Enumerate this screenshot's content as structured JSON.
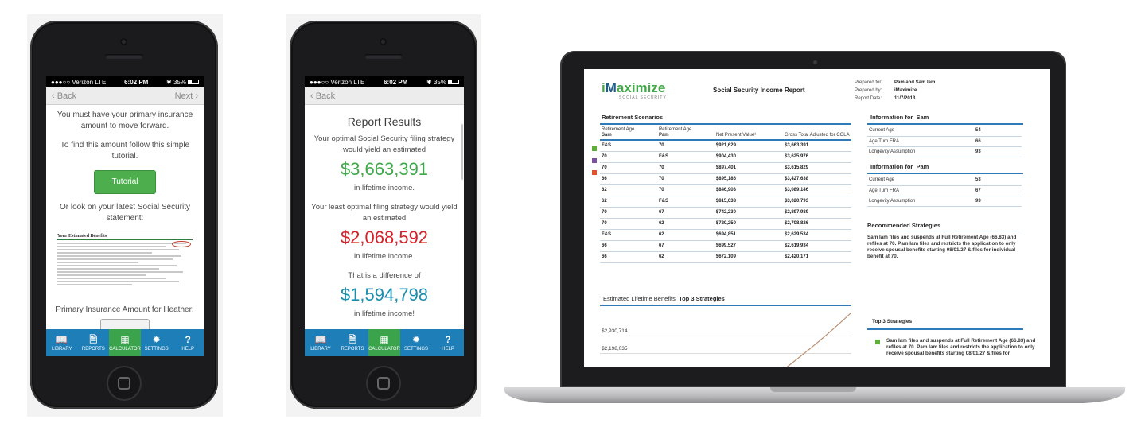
{
  "phone1": {
    "status": {
      "carrier": "●●●○○ Verizon  LTE",
      "time": "6:02 PM",
      "battery": "✱ 35%"
    },
    "nav": {
      "back": "‹  Back",
      "next": "Next  ›"
    },
    "text1": "You must have your primary insurance amount to move forward.",
    "text2": "To find this amount follow this simple tutorial.",
    "tutorial_button": "Tutorial",
    "text3": "Or look on your latest Social Security statement:",
    "statement_title": "Your Estimated Benefits",
    "pia_label": "Primary Insurance Amount for Heather:"
  },
  "phone2": {
    "status": {
      "carrier": "●●●○○ Verizon  LTE",
      "time": "6:02 PM",
      "battery": "✱ 35%"
    },
    "nav": {
      "back": "‹  Back"
    },
    "title": "Report Results",
    "optimal_text": "Your optimal Social Security filing strategy would yield an estimated",
    "optimal_amount": "$3,663,391",
    "lifetime1": "in lifetime income.",
    "least_text": "Your least optimal filing strategy would yield an estimated",
    "least_amount": "$2,068,592",
    "lifetime2": "in lifetime income.",
    "diff_text": "That is a difference of",
    "diff_amount": "$1,594,798",
    "lifetime3": "in lifetime income!"
  },
  "tabs": [
    {
      "icon": "📖",
      "label": "LIBRARY"
    },
    {
      "icon": "🗎",
      "label": "REPORTS"
    },
    {
      "icon": "▦",
      "label": "CALCULATOR"
    },
    {
      "icon": "✹",
      "label": "SETTINGS"
    },
    {
      "icon": "?",
      "label": "HELP"
    }
  ],
  "report": {
    "logo_i": "i",
    "logo_m": "M",
    "logo_rest": "aximize",
    "logo_sub": "SOCIAL SECURITY",
    "title": "Social Security Income Report",
    "prepared_for_label": "Prepared for:",
    "prepared_for": "Pam and Sam Iam",
    "prepared_by_label": "Prepared by:",
    "prepared_by": "iMaximize",
    "date_label": "Report Date:",
    "date": "11/7/2013",
    "scenarios_heading": "Retirement Scenarios",
    "columns": {
      "sam_age": "Retirement Age",
      "sam": "Sam",
      "pam_age": "Retirement Age",
      "pam": "Pam",
      "npv": "Net Present Value¹",
      "gross": "Gross Total Adjusted for COLA"
    },
    "rows": [
      {
        "sam": "F&S",
        "pam": "70",
        "npv": "$921,629",
        "gross": "$3,663,391"
      },
      {
        "sam": "70",
        "pam": "F&S",
        "npv": "$904,430",
        "gross": "$3,625,976"
      },
      {
        "sam": "70",
        "pam": "70",
        "npv": "$897,401",
        "gross": "$3,615,829"
      },
      {
        "sam": "66",
        "pam": "70",
        "npv": "$895,186",
        "gross": "$3,427,638"
      },
      {
        "sam": "62",
        "pam": "70",
        "npv": "$846,903",
        "gross": "$3,089,146"
      },
      {
        "sam": "62",
        "pam": "F&S",
        "npv": "$815,038",
        "gross": "$3,020,793"
      },
      {
        "sam": "70",
        "pam": "67",
        "npv": "$742,230",
        "gross": "$2,897,989"
      },
      {
        "sam": "70",
        "pam": "62",
        "npv": "$720,250",
        "gross": "$2,708,826"
      },
      {
        "sam": "F&S",
        "pam": "62",
        "npv": "$694,851",
        "gross": "$2,629,534"
      },
      {
        "sam": "66",
        "pam": "67",
        "npv": "$699,527",
        "gross": "$2,619,934"
      },
      {
        "sam": "66",
        "pam": "62",
        "npv": "$672,109",
        "gross": "$2,420,171"
      }
    ],
    "marker_colors": [
      "#5fae3a",
      "#7b4fa0",
      "#e0522c"
    ],
    "info_sam_label": "Information for",
    "info_sam_name": "Sam",
    "info_sam": [
      {
        "k": "Current Age",
        "v": "54"
      },
      {
        "k": "Age Turn FRA",
        "v": "66"
      },
      {
        "k": "Longevity Assumption",
        "v": "93"
      }
    ],
    "info_pam_label": "Information for",
    "info_pam_name": "Pam",
    "info_pam": [
      {
        "k": "Current Age",
        "v": "53"
      },
      {
        "k": "Age Turn FRA",
        "v": "67"
      },
      {
        "k": "Longevity Assumption",
        "v": "93"
      }
    ],
    "recommended_heading": "Recommended Strategies",
    "recommended_text": "Sam Iam files and suspends at Full Retirement Age (66.83) and refiles at 70. Pam Iam files and restricts the application to only receive spousal benefits starting 08/01/27 & files for individual benefit at 70.",
    "lifetime_heading": "Estimated Lifetime Benefits",
    "lifetime_sub": "Top 3 Strategies",
    "chart_labels": [
      "$2,930,714",
      "$2,198,035"
    ],
    "top3_heading": "Top 3 Strategies",
    "top3_text": "Sam Iam files and suspends at Full Retirement Age (66.83) and refiles at 70. Pam Iam files and restricts the application to only receive spousal benefits starting 08/01/27 & files for"
  }
}
